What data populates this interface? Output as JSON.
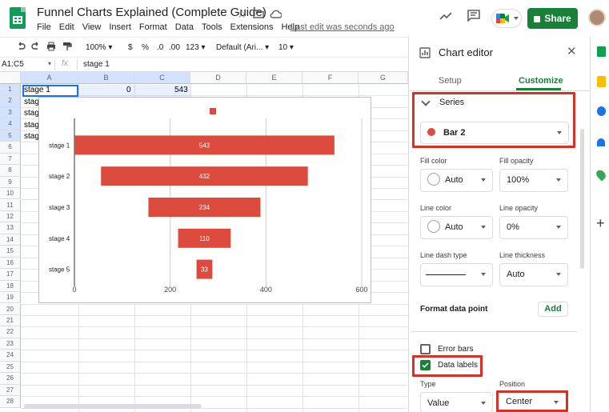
{
  "header": {
    "doc_title": "Funnel Charts Explained (Complete Guide)",
    "menu": [
      "File",
      "Edit",
      "View",
      "Insert",
      "Format",
      "Data",
      "Tools",
      "Extensions",
      "Help"
    ],
    "last_edit": "Last edit was seconds ago",
    "share_label": "Share"
  },
  "toolbar": {
    "zoom": "100%",
    "currency": "$",
    "percent": "%",
    "dec_less": ".0",
    "dec_more": ".00",
    "number_format": "123",
    "font": "Default (Ari...",
    "font_size": "10"
  },
  "formula_bar": {
    "range": "A1:C5",
    "fx": "fx",
    "content": "stage 1"
  },
  "grid": {
    "columns": [
      "A",
      "B",
      "C",
      "D",
      "E",
      "F",
      "G"
    ],
    "rows": [
      "1",
      "2",
      "3",
      "4",
      "5",
      "6",
      "7",
      "8",
      "9",
      "10",
      "11",
      "12",
      "13",
      "14",
      "15",
      "16",
      "17",
      "18",
      "19",
      "20",
      "21",
      "22",
      "23",
      "24",
      "25",
      "26",
      "27",
      "28"
    ],
    "cells": {
      "a1": "stage 1",
      "b1": "0",
      "c1": "543",
      "a2": "stag",
      "a3": "stag",
      "a4": "stag",
      "a5": "stag"
    }
  },
  "chart_data": {
    "type": "bar",
    "orientation": "horizontal",
    "stacked": true,
    "categories": [
      "stage 1",
      "stage 2",
      "stage 3",
      "stage 4",
      "stage 5"
    ],
    "series": [
      {
        "values": [
          0,
          55.5,
          154.5,
          216.5,
          255
        ],
        "color": "transparent"
      },
      {
        "values": [
          543,
          432,
          234,
          110,
          33
        ],
        "color": "#dd4b3e"
      }
    ],
    "data_labels": [
      "543",
      "432",
      "234",
      "110",
      "33"
    ],
    "xticks": [
      "0",
      "200",
      "400",
      "600"
    ],
    "xlim": [
      0,
      600
    ],
    "legend": "top",
    "legend_color": "#dd4b3e",
    "grid": true
  },
  "panel": {
    "title": "Chart editor",
    "tabs": [
      "Setup",
      "Customize"
    ],
    "active_tab": "Customize",
    "section_series": "Series",
    "series_select": "Bar 2",
    "series_color": "#dd4b3e",
    "fill_color_label": "Fill color",
    "fill_color_value": "Auto",
    "fill_opacity_label": "Fill opacity",
    "fill_opacity_value": "100%",
    "line_color_label": "Line color",
    "line_color_value": "Auto",
    "line_opacity_label": "Line opacity",
    "line_opacity_value": "0%",
    "line_dash_label": "Line dash type",
    "line_thickness_label": "Line thickness",
    "line_thickness_value": "Auto",
    "format_point_label": "Format data point",
    "add_label": "Add",
    "error_bars_label": "Error bars",
    "data_labels_label": "Data labels",
    "type_label": "Type",
    "type_value": "Value",
    "position_label": "Position",
    "position_value": "Center"
  },
  "colors": {
    "share_green": "#188038",
    "highlight_red": "#d93025",
    "customize_green": "#188038"
  }
}
